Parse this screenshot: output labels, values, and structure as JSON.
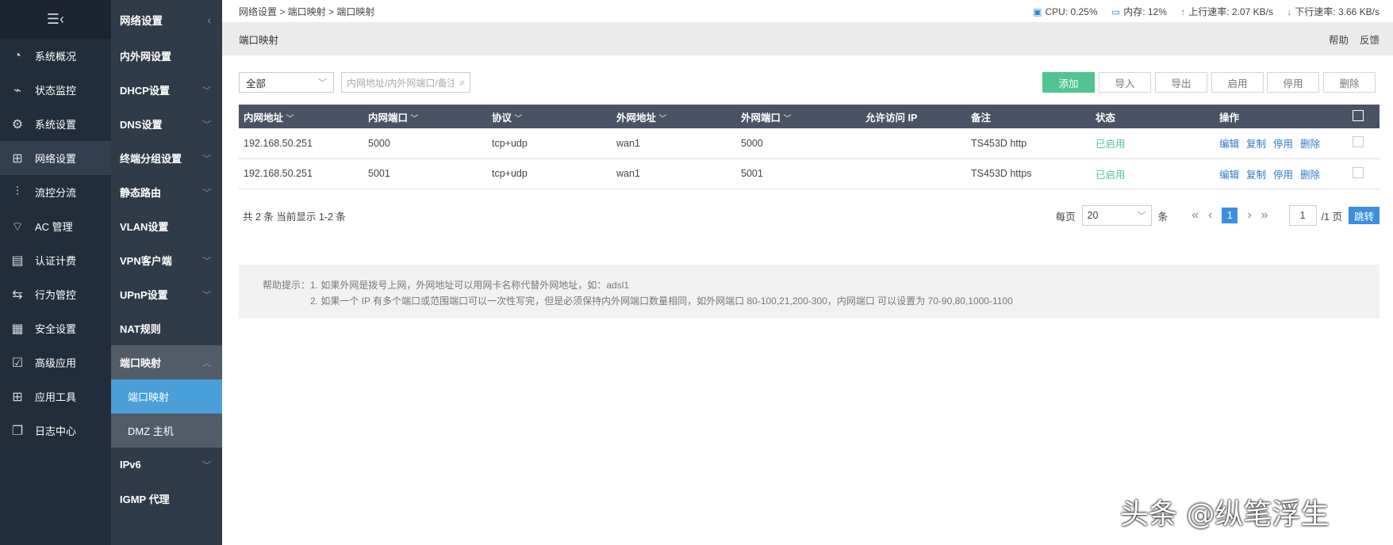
{
  "nav1": {
    "items": [
      {
        "label": "系统概况",
        "icon": "dashboard-icon",
        "glyph": "◔"
      },
      {
        "label": "状态监控",
        "icon": "pulse-monitor-icon",
        "glyph": "⌁"
      },
      {
        "label": "系统设置",
        "icon": "gear-icon",
        "glyph": "⚙"
      },
      {
        "label": "网络设置",
        "icon": "network-icon",
        "glyph": "⊞"
      },
      {
        "label": "流控分流",
        "icon": "sliders-icon",
        "glyph": "⫶"
      },
      {
        "label": "AC 管理",
        "icon": "wifi-ap-icon",
        "glyph": "⌔"
      },
      {
        "label": "认证计费",
        "icon": "id-card-icon",
        "glyph": "▤"
      },
      {
        "label": "行为管控",
        "icon": "arrows-exchange-icon",
        "glyph": "⇆"
      },
      {
        "label": "安全设置",
        "icon": "firewall-icon",
        "glyph": "▦"
      },
      {
        "label": "高级应用",
        "icon": "calendar-check-icon",
        "glyph": "☑"
      },
      {
        "label": "应用工具",
        "icon": "tools-grid-icon",
        "glyph": "⊞"
      },
      {
        "label": "日志中心",
        "icon": "document-icon",
        "glyph": "❐"
      }
    ]
  },
  "nav2": {
    "title": "网络设置",
    "items": [
      "内外网设置",
      "DHCP设置",
      "DNS设置",
      "终端分组设置",
      "静态路由",
      "VLAN设置",
      "VPN客户端",
      "UPnP设置",
      "NAT规则",
      "端口映射",
      "端口映射",
      "DMZ 主机",
      "IPv6",
      "IGMP 代理"
    ]
  },
  "breadcrumb": "网络设置 > 端口映射 > 端口映射",
  "stats": {
    "cpu": "CPU: 0.25%",
    "mem": "内存: 12%",
    "up": "上行速率: 2.07 KB/s",
    "down": "下行速率: 3.66 KB/s"
  },
  "page_title": "端口映射",
  "help_link": "帮助",
  "feedback_link": "反馈",
  "filter": {
    "value": "全部",
    "search_placeholder": "内网地址/内外网端口/备注"
  },
  "buttons": {
    "add": "添加",
    "import": "导入",
    "export": "导出",
    "enable": "启用",
    "disable": "停用",
    "delete": "删除"
  },
  "table": {
    "headers": [
      "内网地址",
      "内网端口",
      "协议",
      "外网地址",
      "外网端口",
      "允许访问 IP",
      "备注",
      "状态",
      "操作"
    ],
    "rows": [
      {
        "ip": "192.168.50.251",
        "port": "5000",
        "proto": "tcp+udp",
        "wan": "wan1",
        "wport": "5000",
        "allow": "",
        "note": "TS453D http",
        "status": "已启用"
      },
      {
        "ip": "192.168.50.251",
        "port": "5001",
        "proto": "tcp+udp",
        "wan": "wan1",
        "wport": "5001",
        "allow": "",
        "note": "TS453D https",
        "status": "已启用"
      }
    ],
    "actions": [
      "编辑",
      "复制",
      "停用",
      "删除"
    ]
  },
  "pagination": {
    "summary": "共 2 条 当前显示 1-2 条",
    "per_page_label": "每页",
    "per_page": "20",
    "unit": "条",
    "current": "1",
    "page_input": "1",
    "total": "/1 页",
    "jump": "跳转"
  },
  "help": {
    "line1": "帮助提示：1. 如果外网是拨号上网，外网地址可以用网卡名称代替外网地址，如：adsl1",
    "line2": "2. 如果一个 IP 有多个端口或范围端口可以一次性写完，但是必须保持内外网端口数量相同，如外网端口 80-100,21,200-300，内网端口 可以设置为 70-90,80,1000-1100"
  },
  "watermark": "头条 @纵笔浮生"
}
